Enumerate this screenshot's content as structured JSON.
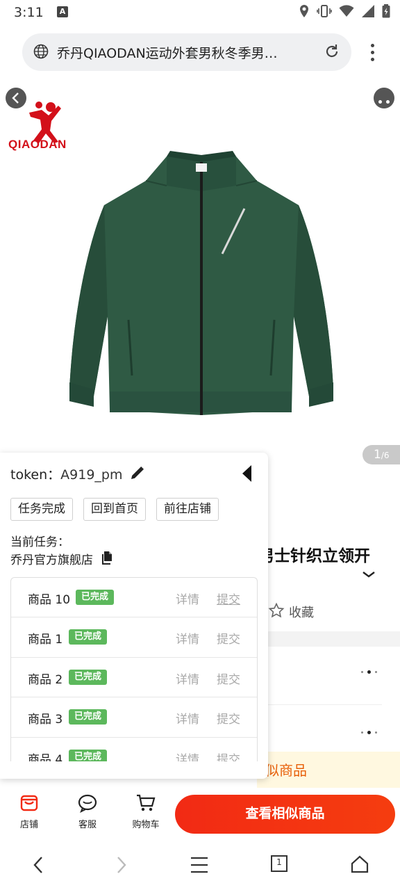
{
  "status_bar": {
    "time": "3:11",
    "notification_letter": "A"
  },
  "url_bar": {
    "text": "乔丹QIAODAN运动外套男秋冬季男…"
  },
  "product": {
    "brand": "QIAODAN",
    "image_index": "1",
    "image_total": "/6",
    "title_visible": "男士针织立领开",
    "favorite_label": "收藏",
    "similar_peek": "似商品",
    "jacket_color": "#2f5a44"
  },
  "task_panel": {
    "token_label": "token：",
    "token_value": "A919_pm",
    "buttons": [
      "任务完成",
      "回到首页",
      "前往店铺"
    ],
    "current_task_label": "当前任务：",
    "current_task_value": "乔丹官方旗舰店",
    "rows": [
      {
        "name": "商品 10",
        "status": "已完成",
        "detail": "详情",
        "submit": "提交"
      },
      {
        "name": "商品 1",
        "status": "已完成",
        "detail": "详情",
        "submit": "提交"
      },
      {
        "name": "商品 2",
        "status": "已完成",
        "detail": "详情",
        "submit": "提交"
      },
      {
        "name": "商品 3",
        "status": "已完成",
        "detail": "详情",
        "submit": "提交"
      },
      {
        "name": "商品 4",
        "status": "已完成",
        "detail": "详情",
        "submit": "提交"
      }
    ]
  },
  "action_bar": {
    "store": "店铺",
    "service": "客服",
    "cart": "购物车",
    "primary": "查看相似商品"
  },
  "browser_nav": {
    "tab_count": "1"
  },
  "colors": {
    "accent": "#f22a14",
    "badge": "#5cb85c",
    "brand_red": "#d3101a"
  }
}
